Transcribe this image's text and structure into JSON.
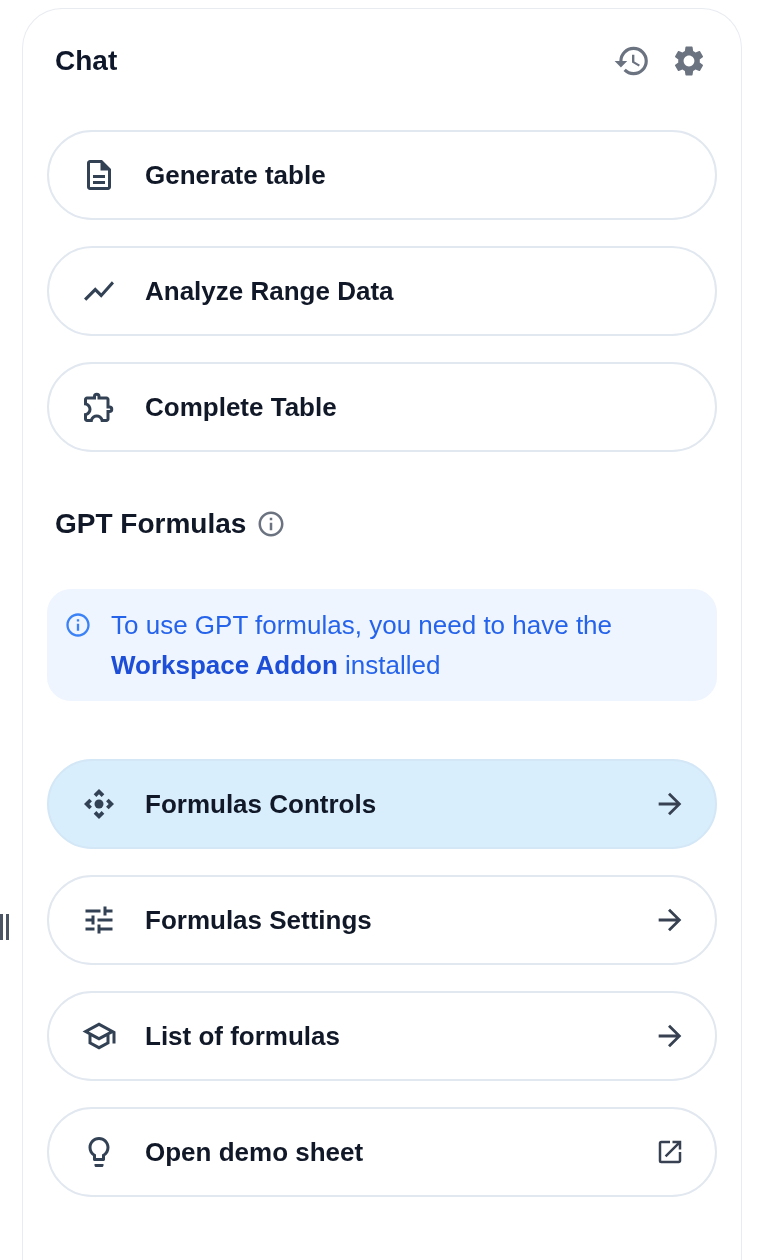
{
  "header": {
    "title": "Chat"
  },
  "actions": [
    {
      "label": "Generate table"
    },
    {
      "label": "Analyze Range Data"
    },
    {
      "label": "Complete Table"
    }
  ],
  "gpt_formulas": {
    "title": "GPT Formulas",
    "notice": {
      "text": "To use GPT formulas, you need to have the",
      "link": "Workspace Addon",
      "text_after": "installed"
    }
  },
  "links": [
    {
      "label": "Formulas Controls",
      "kind": "navigate",
      "selected": true
    },
    {
      "label": "Formulas Settings",
      "kind": "navigate",
      "selected": false
    },
    {
      "label": "List of formulas",
      "kind": "navigate",
      "selected": false
    },
    {
      "label": "Open demo sheet",
      "kind": "external",
      "selected": false
    }
  ]
}
